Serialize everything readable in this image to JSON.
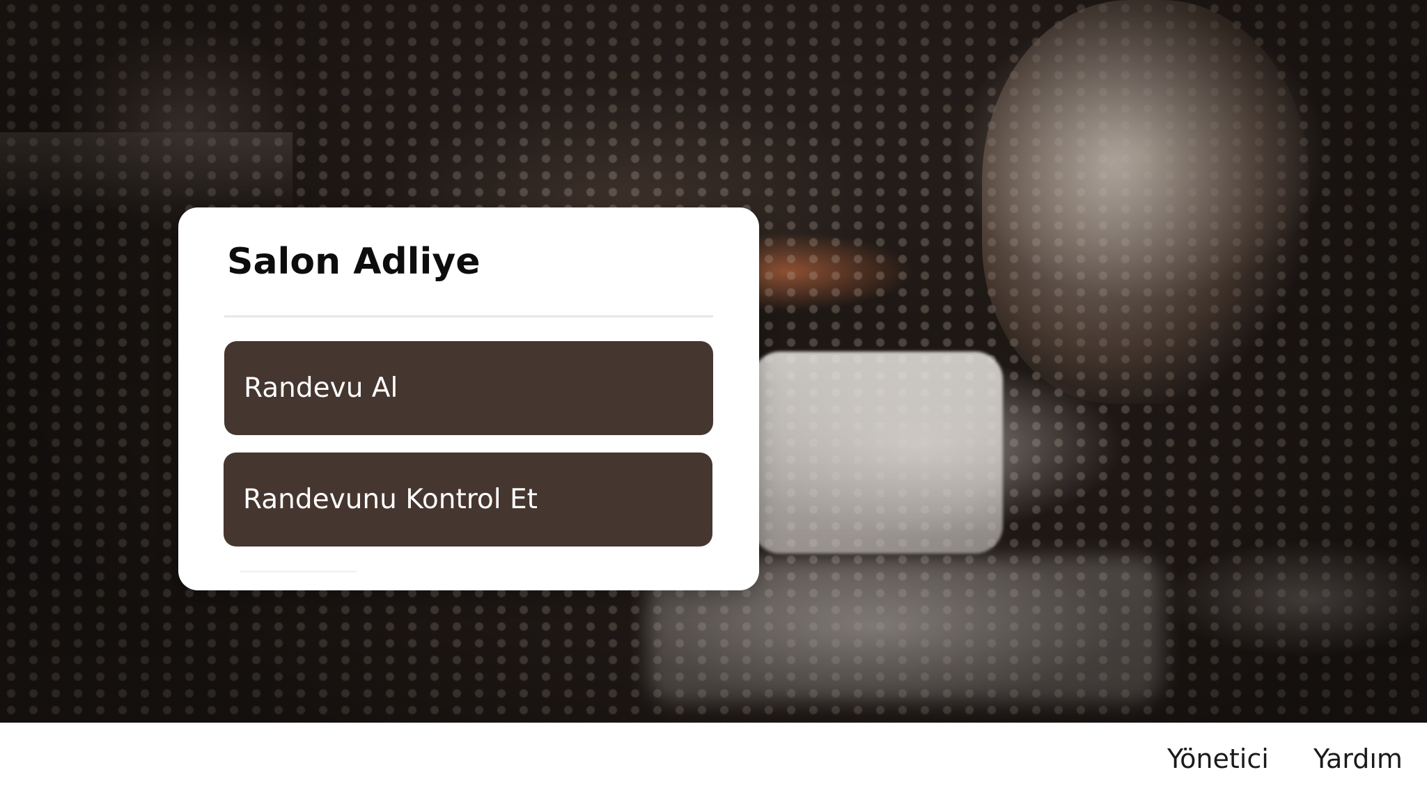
{
  "card": {
    "title": "Salon Adliye",
    "buttons": {
      "book_label": "Randevu Al",
      "check_label": "Randevunu Kontrol Et"
    }
  },
  "nav": {
    "admin_label": "Yönetici",
    "help_label": "Yardım"
  },
  "colors": {
    "button_bg": "#463630",
    "card_bg": "#ffffff",
    "text_dark": "#0d0d0d"
  }
}
